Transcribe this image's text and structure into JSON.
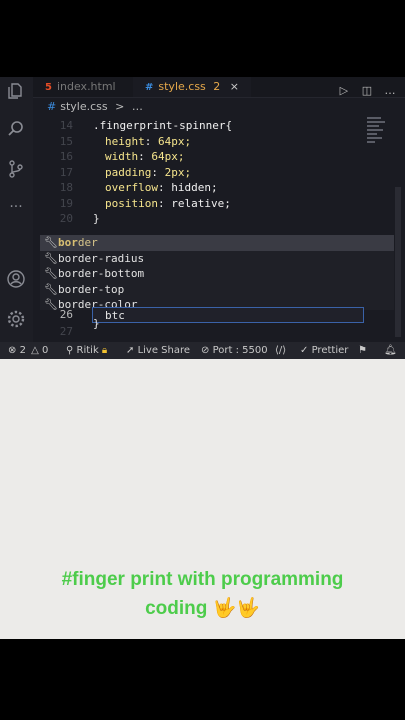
{
  "tabs": [
    {
      "icon": "5",
      "label": "index.html",
      "active": false
    },
    {
      "icon": "#",
      "label": "style.css",
      "badge": "2",
      "close": "×",
      "active": true
    }
  ],
  "tab_actions": [
    "▷",
    "◫",
    "…"
  ],
  "breadcrumb": {
    "icon": "#",
    "file": "style.css",
    "sep": ">",
    "more": "…"
  },
  "code_lines": [
    {
      "num": "14",
      "text": ".fingerprint-spinner{"
    },
    {
      "num": "15",
      "prop": "height",
      "value": "64px;"
    },
    {
      "num": "16",
      "prop": "width",
      "value": "64px;"
    },
    {
      "num": "17",
      "prop": "padding",
      "value": "2px;"
    },
    {
      "num": "18",
      "prop": "overflow",
      "value": "hidden;"
    },
    {
      "num": "19",
      "prop": "position",
      "value": "relative;"
    },
    {
      "num": "20",
      "text": "}"
    }
  ],
  "suggestions": [
    {
      "match": "bor",
      "rest": "der",
      "label": "border"
    },
    {
      "label": "border-radius"
    },
    {
      "label": "border-bottom"
    },
    {
      "label": "border-top"
    },
    {
      "label": "border-color"
    }
  ],
  "current_line": {
    "num": "26",
    "input": "btc",
    "after": "}",
    "next_num": "27"
  },
  "status": {
    "errors": "2",
    "warnings": "0",
    "branch": "Ritik",
    "live_share": "Live Share",
    "port": "Port : 5500",
    "prettier": "Prettier"
  },
  "caption": {
    "line1": "#finger print with programming",
    "line2": "coding 🤟🤟"
  }
}
